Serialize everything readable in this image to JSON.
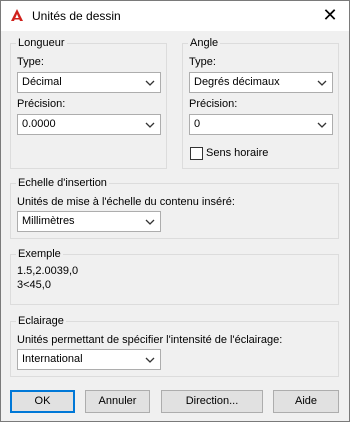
{
  "window": {
    "title": "Unités de dessin",
    "close_glyph": "✕"
  },
  "longueur": {
    "legend": "Longueur",
    "type_label": "Type:",
    "type_value": "Décimal",
    "precision_label": "Précision:",
    "precision_value": "0.0000"
  },
  "angle": {
    "legend": "Angle",
    "type_label": "Type:",
    "type_value": "Degrés décimaux",
    "precision_label": "Précision:",
    "precision_value": "0",
    "clockwise_label": "Sens horaire",
    "clockwise_checked": false
  },
  "insertion": {
    "legend": "Echelle d'insertion",
    "desc": "Unités de mise à l'échelle du contenu inséré:",
    "value": "Millimètres"
  },
  "exemple": {
    "legend": "Exemple",
    "line1": "1.5,2.0039,0",
    "line2": "3<45,0"
  },
  "eclairage": {
    "legend": "Eclairage",
    "desc": "Unités permettant de spécifier l'intensité de l'éclairage:",
    "value": "International"
  },
  "buttons": {
    "ok": "OK",
    "cancel": "Annuler",
    "direction": "Direction...",
    "help": "Aide"
  },
  "colors": {
    "accent": "#0078d7",
    "app_icon": "#d0211c"
  },
  "icons": {
    "app": "autocad-a-icon",
    "close": "close-icon",
    "dropdown": "chevron-down-icon"
  }
}
